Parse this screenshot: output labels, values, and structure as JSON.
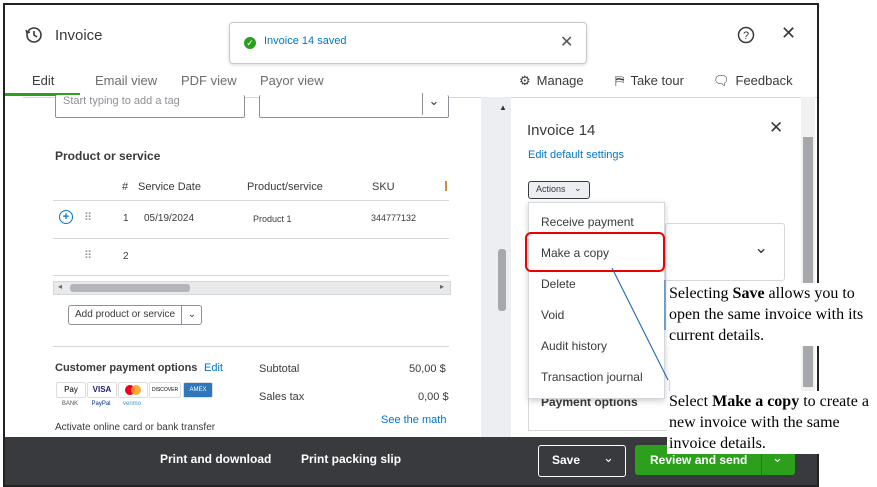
{
  "header": {
    "title": "Invoice",
    "toast_message": "Invoice 14 saved"
  },
  "tabs": [
    "Edit",
    "Email view",
    "PDF view",
    "Payor view"
  ],
  "toolbar": {
    "manage": "Manage",
    "take_tour": "Take tour",
    "feedback": "Feedback"
  },
  "form": {
    "tag_placeholder": "Start typing to add a tag",
    "section_title": "Product or service",
    "columns": [
      "#",
      "Service Date",
      "Product/service",
      "SKU"
    ],
    "rows": [
      {
        "num": "1",
        "date": "05/19/2024",
        "product": "Product 1",
        "sku": "344777132"
      },
      {
        "num": "2",
        "date": "",
        "product": "",
        "sku": ""
      }
    ],
    "add_product_label": "Add product or service",
    "customer_payment_options": "Customer payment options",
    "edit_link": "Edit",
    "subtotal_label": "Subtotal",
    "subtotal_value": "50,00 $",
    "sales_tax_label": "Sales tax",
    "sales_tax_value": "0,00 $",
    "see_the_math": "See the math",
    "activate_text": "Activate online card or bank transfer",
    "payment_logos": [
      "Pay",
      "VISA",
      "",
      "DISCOVER",
      "AMEX",
      "BANK",
      "PayPal",
      "venmo"
    ]
  },
  "panel": {
    "title": "Invoice 14",
    "edit_default": "Edit default settings",
    "actions_label": "Actions",
    "menu_items": [
      "Receive payment",
      "Make a copy",
      "Delete",
      "Void",
      "Audit history",
      "Transaction journal"
    ],
    "payment_options": "Payment options"
  },
  "footer": {
    "print_download": "Print and download",
    "print_packing": "Print packing slip",
    "save": "Save",
    "review_send": "Review and send"
  },
  "annotations": {
    "save_note": [
      "Selecting ",
      "Save",
      " allows you to open the same invoice with its current details."
    ],
    "copy_note": [
      "Select ",
      "Make a copy",
      " to create a new invoice with the same invoice details."
    ]
  },
  "colors": {
    "accent_green": "#2ca01c",
    "link_blue": "#0077c5",
    "highlight_red": "#e00000",
    "footer_bg": "#393a3d"
  }
}
